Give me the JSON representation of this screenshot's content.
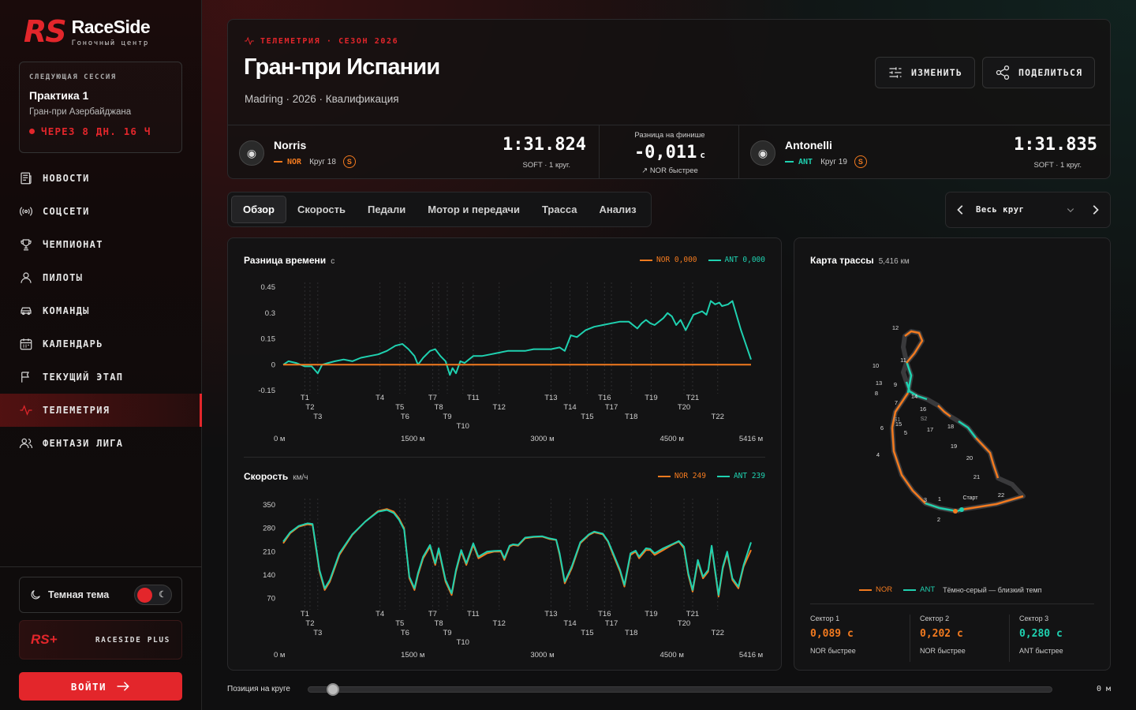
{
  "brand": {
    "logo_mark": "RS",
    "name": "RaceSide",
    "tagline": "Гоночный центр"
  },
  "next_session": {
    "label": "СЛЕДУЮЩАЯ СЕССИЯ",
    "title": "Практика 1",
    "event": "Гран-при Азербайджана",
    "countdown": "ЧЕРЕЗ 8 ДН. 16 Ч"
  },
  "nav": [
    {
      "label": "НОВОСТИ",
      "icon": "news-icon"
    },
    {
      "label": "СОЦСЕТИ",
      "icon": "broadcast-icon"
    },
    {
      "label": "ЧЕМПИОНАТ",
      "icon": "trophy-icon"
    },
    {
      "label": "ПИЛОТЫ",
      "icon": "user-icon"
    },
    {
      "label": "КОМАНДЫ",
      "icon": "car-icon"
    },
    {
      "label": "КАЛЕНДАРЬ",
      "icon": "calendar-icon"
    },
    {
      "label": "ТЕКУЩИЙ ЭТАП",
      "icon": "flag-icon"
    },
    {
      "label": "ТЕЛЕМЕТРИЯ",
      "icon": "pulse-icon",
      "active": true
    },
    {
      "label": "ФЕНТАЗИ ЛИГА",
      "icon": "users-icon"
    }
  ],
  "theme": {
    "label": "Темная тема",
    "enabled": true
  },
  "plus": {
    "mark": "RS+",
    "label": "RACESIDE PLUS"
  },
  "login": {
    "label": "ВОЙТИ"
  },
  "header": {
    "eyebrow": "ТЕЛЕМЕТРИЯ · СЕЗОН 2026",
    "title": "Гран-при Испании",
    "meta": "Madring · 2026 · Квалификация",
    "edit_label": "ИЗМЕНИТЬ",
    "share_label": "ПОДЕЛИТЬСЯ"
  },
  "driver1": {
    "name": "Norris",
    "code": "NOR",
    "lap": "Круг 18",
    "tyre": "S",
    "time": "1:31.824",
    "sub": "SOFT · 1 круг.",
    "color": "#f27a1f"
  },
  "driver2": {
    "name": "Antonelli",
    "code": "ANT",
    "lap": "Круг 19",
    "tyre": "S",
    "time": "1:31.835",
    "sub": "SOFT · 1 круг.",
    "color": "#1fd1b0"
  },
  "finish_diff": {
    "label": "Разница на финише",
    "value": "-0,011",
    "unit": "с",
    "note": "NOR быстрее"
  },
  "tabs": [
    "Обзор",
    "Скорость",
    "Педали",
    "Мотор и передачи",
    "Трасса",
    "Анализ"
  ],
  "active_tab": 0,
  "lap_selector": {
    "value": "Весь круг"
  },
  "delta_chart": {
    "title": "Разница времени",
    "unit": "с",
    "legend_nor": "NOR 0,000",
    "legend_ant": "ANT 0,000"
  },
  "speed_chart": {
    "title": "Скорость",
    "unit": "км/ч",
    "legend_nor": "NOR 249",
    "legend_ant": "ANT 239"
  },
  "track": {
    "title": "Карта трассы",
    "length": "5,416 км",
    "start_label": "Старт",
    "legend_nor": "NOR",
    "legend_ant": "ANT",
    "legend_note": "Тёмно-серый — близкий темп",
    "corners": [
      "1",
      "2",
      "3",
      "4",
      "5",
      "6",
      "7",
      "8",
      "9",
      "10",
      "11",
      "12",
      "13",
      "14",
      "15",
      "16",
      "17",
      "18",
      "19",
      "20",
      "21",
      "22"
    ],
    "sector_markers": [
      "S1",
      "S2"
    ]
  },
  "sectors": [
    {
      "label": "Сектор 1",
      "value": "0,089 с",
      "note": "NOR быстрее",
      "color": "#f27a1f"
    },
    {
      "label": "Сектор 2",
      "value": "0,202 с",
      "note": "NOR быстрее",
      "color": "#f27a1f"
    },
    {
      "label": "Сектор 3",
      "value": "0,280 с",
      "note": "ANT быстрее",
      "color": "#1fd1b0"
    }
  ],
  "lap_position": {
    "label": "Позиция на круге",
    "value": "0 м"
  },
  "chart_data": [
    {
      "type": "line",
      "title": "Разница времени",
      "ylabel": "с",
      "ylim": [
        -0.15,
        0.45
      ],
      "y_ticks": [
        "0.45",
        "0.3",
        "0.15",
        "0",
        "-0.15"
      ],
      "xlim": [
        0,
        5416
      ],
      "x_ticks": [
        "0 м",
        "1500 м",
        "3000 м",
        "4500 м",
        "5416 м"
      ],
      "turns": [
        {
          "t": "T1",
          "x": 250
        },
        {
          "t": "T2",
          "x": 310
        },
        {
          "t": "T3",
          "x": 400
        },
        {
          "t": "T4",
          "x": 1120
        },
        {
          "t": "T5",
          "x": 1350
        },
        {
          "t": "T6",
          "x": 1410
        },
        {
          "t": "T7",
          "x": 1730
        },
        {
          "t": "T8",
          "x": 1800
        },
        {
          "t": "T9",
          "x": 1900
        },
        {
          "t": "T10",
          "x": 2080
        },
        {
          "t": "T11",
          "x": 2200
        },
        {
          "t": "T12",
          "x": 2500
        },
        {
          "t": "T13",
          "x": 3100
        },
        {
          "t": "T14",
          "x": 3320
        },
        {
          "t": "T15",
          "x": 3520
        },
        {
          "t": "T16",
          "x": 3720
        },
        {
          "t": "T17",
          "x": 3800
        },
        {
          "t": "T18",
          "x": 4030
        },
        {
          "t": "T19",
          "x": 4260
        },
        {
          "t": "T20",
          "x": 4640
        },
        {
          "t": "T21",
          "x": 4740
        },
        {
          "t": "T22",
          "x": 5030
        }
      ],
      "series": [
        {
          "name": "ANT",
          "color": "#1fd1b0",
          "x": [
            0,
            60,
            150,
            250,
            330,
            400,
            450,
            520,
            600,
            700,
            800,
            900,
            1000,
            1100,
            1200,
            1300,
            1380,
            1450,
            1520,
            1560,
            1620,
            1700,
            1760,
            1820,
            1880,
            1930,
            1960,
            2000,
            2050,
            2100,
            2150,
            2200,
            2300,
            2400,
            2500,
            2600,
            2700,
            2800,
            2900,
            3000,
            3100,
            3200,
            3260,
            3330,
            3400,
            3500,
            3600,
            3700,
            3800,
            3900,
            4000,
            4100,
            4150,
            4200,
            4250,
            4300,
            4350,
            4400,
            4450,
            4500,
            4550,
            4600,
            4620,
            4660,
            4700,
            4750,
            4800,
            4850,
            4900,
            4950,
            5000,
            5050,
            5080,
            5150,
            5200,
            5300,
            5416
          ],
          "values": [
            0,
            0.02,
            0.01,
            -0.01,
            -0.01,
            -0.05,
            0,
            0.01,
            0.02,
            0.03,
            0.02,
            0.04,
            0.05,
            0.06,
            0.08,
            0.11,
            0.12,
            0.09,
            0.05,
            0,
            0.04,
            0.08,
            0.09,
            0.05,
            0.02,
            -0.06,
            -0.02,
            -0.05,
            0.02,
            0.01,
            0.03,
            0.05,
            0.05,
            0.06,
            0.07,
            0.08,
            0.08,
            0.08,
            0.09,
            0.09,
            0.09,
            0.1,
            0.08,
            0.17,
            0.16,
            0.2,
            0.22,
            0.23,
            0.24,
            0.25,
            0.25,
            0.21,
            0.24,
            0.26,
            0.24,
            0.23,
            0.25,
            0.27,
            0.3,
            0.28,
            0.23,
            0.26,
            0.24,
            0.2,
            0.24,
            0.29,
            0.3,
            0.31,
            0.29,
            0.37,
            0.35,
            0.36,
            0.34,
            0.35,
            0.37,
            0.2,
            0.03
          ]
        },
        {
          "name": "NOR",
          "color": "#f27a1f",
          "x": [
            0,
            5416
          ],
          "values": [
            0,
            0
          ]
        }
      ]
    },
    {
      "type": "line",
      "title": "Скорость",
      "ylabel": "км/ч",
      "ylim": [
        45,
        355
      ],
      "y_ticks": [
        "350",
        "280",
        "210",
        "140",
        "70"
      ],
      "xlim": [
        0,
        5416
      ],
      "x_ticks": [
        "0 м",
        "1500 м",
        "3000 м",
        "4500 м",
        "5416 м"
      ],
      "series": [
        {
          "name": "NOR",
          "color": "#f27a1f",
          "x": [
            0,
            80,
            180,
            280,
            340,
            420,
            480,
            540,
            650,
            800,
            950,
            1100,
            1200,
            1280,
            1340,
            1400,
            1460,
            1520,
            1560,
            1620,
            1700,
            1760,
            1800,
            1880,
            1950,
            2000,
            2060,
            2120,
            2200,
            2260,
            2360,
            2440,
            2520,
            2560,
            2620,
            2660,
            2720,
            2800,
            2900,
            3000,
            3080,
            3160,
            3200,
            3260,
            3340,
            3440,
            3540,
            3600,
            3700,
            3760,
            3820,
            3900,
            3950,
            4020,
            4080,
            4120,
            4200,
            4250,
            4300,
            4400,
            4500,
            4580,
            4640,
            4690,
            4740,
            4800,
            4860,
            4920,
            4960,
            5040,
            5090,
            5140,
            5200,
            5270,
            5330,
            5416
          ],
          "values": [
            235,
            265,
            285,
            292,
            290,
            150,
            95,
            120,
            200,
            260,
            300,
            332,
            338,
            330,
            310,
            280,
            130,
            95,
            140,
            190,
            225,
            170,
            215,
            120,
            80,
            150,
            210,
            170,
            230,
            190,
            205,
            210,
            210,
            185,
            225,
            230,
            228,
            250,
            254,
            255,
            248,
            245,
            200,
            115,
            160,
            235,
            260,
            268,
            262,
            240,
            200,
            150,
            105,
            200,
            210,
            190,
            215,
            215,
            200,
            215,
            230,
            240,
            220,
            140,
            90,
            180,
            130,
            150,
            225,
            75,
            160,
            205,
            125,
            100,
            165,
            215
          ]
        },
        {
          "name": "ANT",
          "color": "#1fd1b0",
          "x": [
            0,
            80,
            180,
            280,
            340,
            420,
            480,
            540,
            650,
            800,
            950,
            1100,
            1200,
            1280,
            1340,
            1400,
            1460,
            1520,
            1560,
            1620,
            1700,
            1760,
            1800,
            1880,
            1950,
            2000,
            2060,
            2120,
            2200,
            2260,
            2360,
            2440,
            2520,
            2560,
            2620,
            2660,
            2720,
            2800,
            2900,
            3000,
            3080,
            3160,
            3200,
            3260,
            3340,
            3440,
            3540,
            3600,
            3700,
            3760,
            3820,
            3900,
            3950,
            4020,
            4080,
            4120,
            4200,
            4250,
            4300,
            4400,
            4500,
            4580,
            4640,
            4690,
            4740,
            4800,
            4860,
            4920,
            4960,
            5040,
            5090,
            5140,
            5200,
            5270,
            5330,
            5416
          ],
          "values": [
            240,
            268,
            287,
            295,
            293,
            155,
            100,
            125,
            205,
            262,
            300,
            330,
            335,
            326,
            306,
            276,
            135,
            100,
            145,
            195,
            230,
            175,
            220,
            125,
            85,
            155,
            215,
            175,
            235,
            195,
            210,
            212,
            213,
            190,
            228,
            232,
            230,
            252,
            255,
            256,
            250,
            246,
            205,
            120,
            165,
            238,
            262,
            270,
            264,
            242,
            205,
            155,
            110,
            205,
            213,
            195,
            220,
            218,
            205,
            220,
            232,
            242,
            225,
            145,
            95,
            185,
            135,
            155,
            228,
            80,
            165,
            210,
            130,
            105,
            170,
            238
          ]
        }
      ]
    }
  ]
}
